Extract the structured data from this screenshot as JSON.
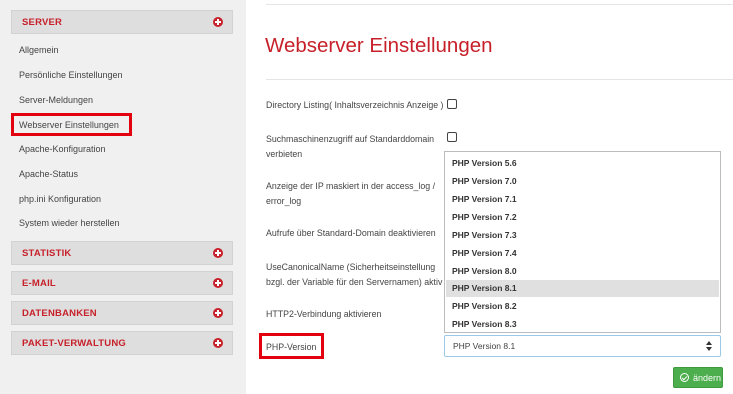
{
  "sidebar": {
    "server": {
      "label": "SERVER"
    },
    "server_items": [
      {
        "label": "Allgemein"
      },
      {
        "label": "Persönliche Einstellungen"
      },
      {
        "label": "Server-Meldungen"
      },
      {
        "label": "Webserver Einstellungen"
      },
      {
        "label": "Apache-Konfiguration"
      },
      {
        "label": "Apache-Status"
      },
      {
        "label": "php.ini Konfiguration"
      },
      {
        "label": "System wieder herstellen"
      }
    ],
    "sections": [
      {
        "label": "STATISTIK"
      },
      {
        "label": "E-MAIL"
      },
      {
        "label": "DATENBANKEN"
      },
      {
        "label": "PAKET-VERWALTUNG"
      }
    ]
  },
  "main": {
    "title": "Webserver Einstellungen",
    "settings": {
      "directory_listing": "Directory Listing( Inhaltsverzeichnis Anzeige )",
      "search_engine_line1": "Suchmaschinenzugriff auf Standarddomain",
      "search_engine_line2": "verbieten",
      "ip_masked_line1": "Anzeige der IP maskiert in der access_log /",
      "ip_masked_line2": "error_log",
      "standard_domain": "Aufrufe über Standard-Domain deaktivieren",
      "canonical_line1": "UseCanonicalName (Sicherheitseinstellung",
      "canonical_line2": "bzgl. der Variable für den Servernamen) aktiv",
      "http2": "HTTP2-Verbindung aktivieren",
      "php_version": "PHP-Version"
    },
    "php_options": [
      "PHP Version 5.6",
      "PHP Version 7.0",
      "PHP Version 7.1",
      "PHP Version 7.2",
      "PHP Version 7.3",
      "PHP Version 7.4",
      "PHP Version 8.0",
      "PHP Version 8.1",
      "PHP Version 8.2",
      "PHP Version 8.3"
    ],
    "php_selected": "PHP Version 8.1",
    "submit_label": "ändern"
  },
  "colors": {
    "accent": "#c7202a",
    "highlight_box": "#e3000f",
    "button_green": "#4cae4c"
  }
}
